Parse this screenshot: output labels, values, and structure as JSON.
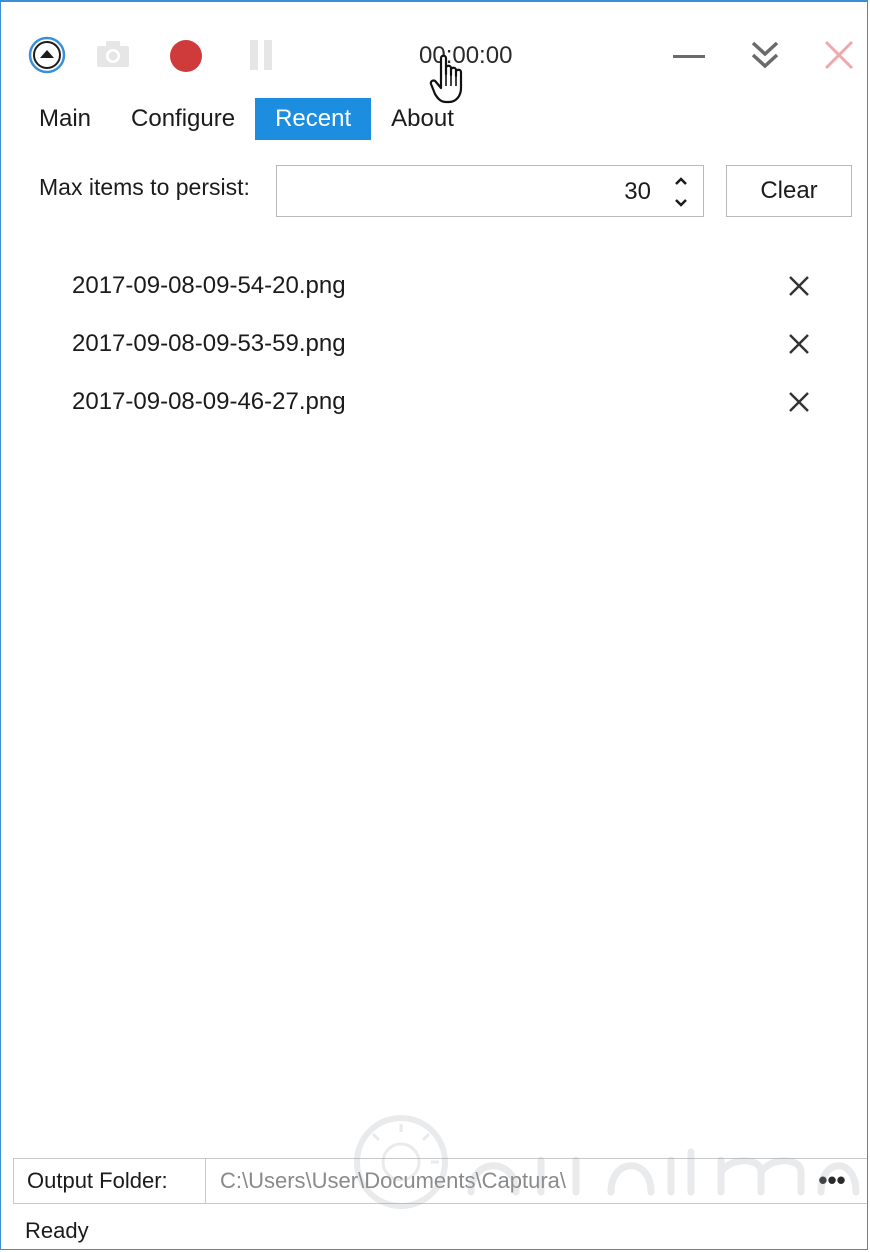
{
  "toolbar": {
    "timer": "00:00:00",
    "record_color": "#cf3a3a",
    "close_color": "#f0a8a8",
    "icons": [
      "chevron-up-circle-icon",
      "camera-icon",
      "record-icon",
      "pause-icon",
      "minimize-icon",
      "double-chevron-down-icon",
      "close-icon"
    ]
  },
  "tabs": [
    {
      "label": "Main",
      "active": false
    },
    {
      "label": "Configure",
      "active": false
    },
    {
      "label": "Recent",
      "active": true
    },
    {
      "label": "About",
      "active": false
    }
  ],
  "accent_color": "#1c8ddf",
  "recent": {
    "max_items_label": "Max items to persist:",
    "max_items_value": "30",
    "clear_label": "Clear",
    "items": [
      {
        "name": "2017-09-08-09-54-20.png"
      },
      {
        "name": "2017-09-08-09-53-59.png"
      },
      {
        "name": "2017-09-08-09-46-27.png"
      }
    ]
  },
  "output": {
    "label": "Output Folder:",
    "path": "C:\\Users\\User\\Documents\\Captura\\",
    "browse_label": "•••"
  },
  "status": "Ready"
}
